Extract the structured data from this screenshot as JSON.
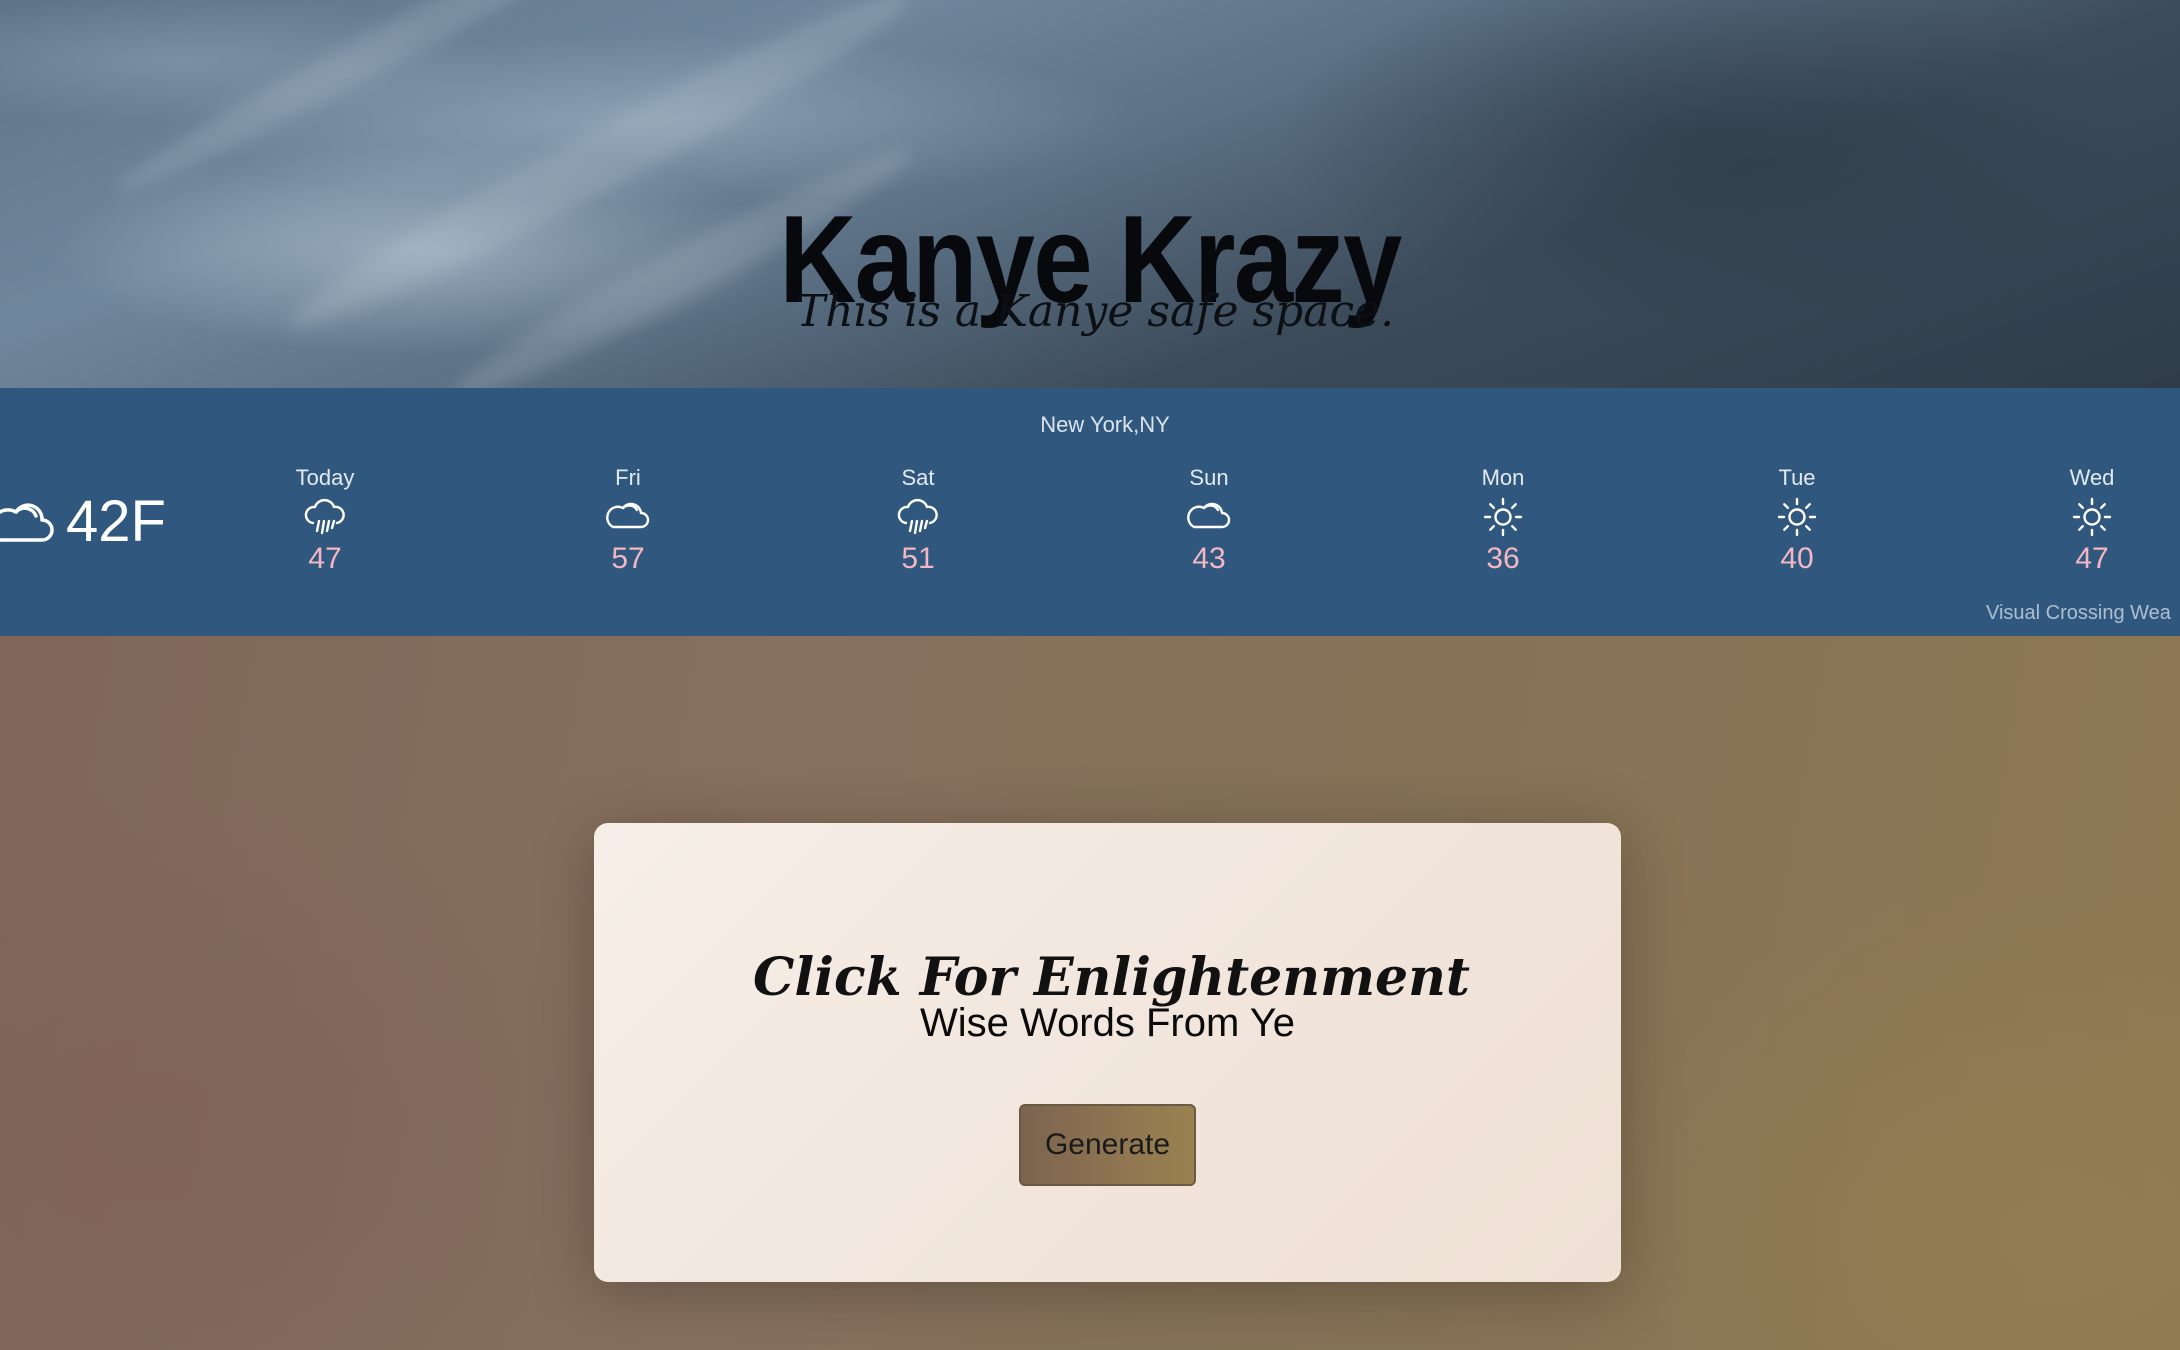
{
  "hero": {
    "title": "Kanye Krazy",
    "subtitle": "This is a Kanye safe space."
  },
  "weather": {
    "location": "New York,NY",
    "current": {
      "icon": "cloud-icon",
      "temp": "42F"
    },
    "days": [
      {
        "name": "Today",
        "icon": "rain-cloud-icon",
        "temp": "47"
      },
      {
        "name": "Fri",
        "icon": "cloud-icon",
        "temp": "57"
      },
      {
        "name": "Sat",
        "icon": "rain-cloud-icon",
        "temp": "51"
      },
      {
        "name": "Sun",
        "icon": "cloud-icon",
        "temp": "43"
      },
      {
        "name": "Mon",
        "icon": "sun-icon",
        "temp": "36"
      },
      {
        "name": "Tue",
        "icon": "sun-icon",
        "temp": "40"
      },
      {
        "name": "Wed",
        "icon": "sun-icon",
        "temp": "47"
      }
    ],
    "credit": "Visual Crossing Wea"
  },
  "card": {
    "title": "Click For Enlightenment",
    "subtitle": "Wise Words From Ye",
    "button_label": "Generate"
  },
  "colors": {
    "weather_bar": "#30587f",
    "forecast_temp": "#f4b6c1",
    "card_background": "#f3e9e1"
  }
}
